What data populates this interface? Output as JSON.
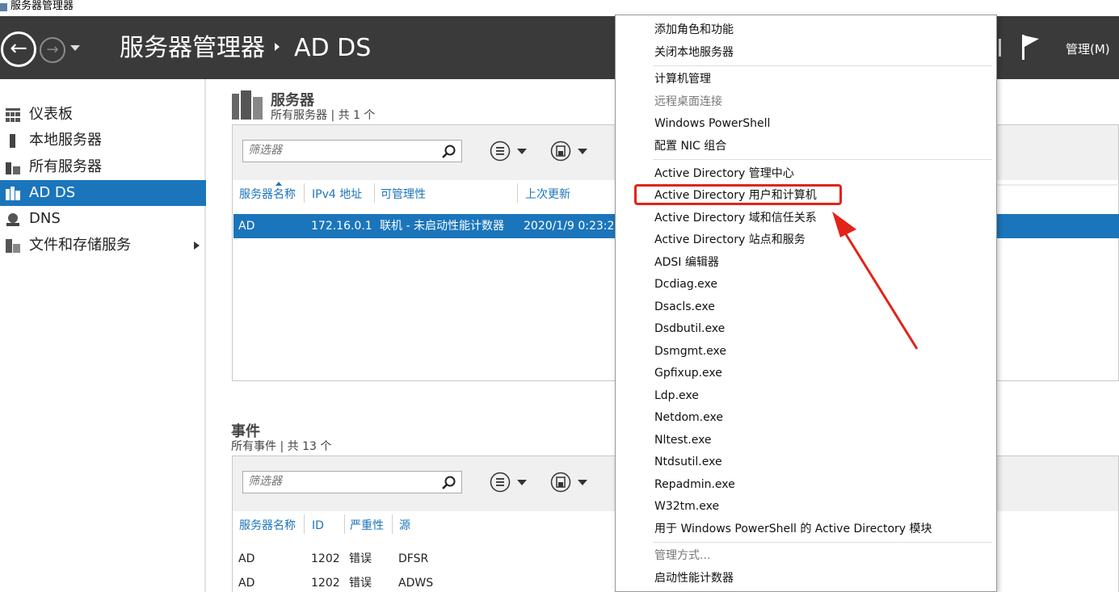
{
  "window": {
    "title": "服务器管理器"
  },
  "header": {
    "breadcrumb_root": "服务器管理器",
    "breadcrumb_current": "AD DS",
    "manage_menu": "管理(M)"
  },
  "sidebar": {
    "items": [
      {
        "label": "仪表板"
      },
      {
        "label": "本地服务器"
      },
      {
        "label": "所有服务器"
      },
      {
        "label": "AD DS"
      },
      {
        "label": "DNS"
      },
      {
        "label": "文件和存储服务"
      }
    ]
  },
  "servers": {
    "title": "服务器",
    "subtitle": "所有服务器 | 共 1 个",
    "filter_placeholder": "筛选器",
    "columns": [
      "服务器名称",
      "IPv4 地址",
      "可管理性",
      "上次更新"
    ],
    "rows": [
      {
        "name": "AD",
        "ipv4": "172.16.0.1",
        "manageability": "联机 - 未启动性能计数器",
        "last_update": "2020/1/9 0:23:2"
      }
    ]
  },
  "events": {
    "title": "事件",
    "subtitle": "所有事件 | 共 13 个",
    "filter_placeholder": "筛选器",
    "columns": [
      "服务器名称",
      "ID",
      "严重性",
      "源"
    ],
    "rows": [
      {
        "server": "AD",
        "id": "1202",
        "severity": "错误",
        "source": "DFSR"
      },
      {
        "server": "AD",
        "id": "1202",
        "severity": "错误",
        "source": "ADWS"
      }
    ]
  },
  "tools_menu": {
    "items": [
      "添加角色和功能",
      "关闭本地服务器",
      "计算机管理",
      "远程桌面连接",
      "Windows PowerShell",
      "配置 NIC 组合",
      "Active Directory 管理中心",
      "Active Directory 用户和计算机",
      "Active Directory 域和信任关系",
      "Active Directory 站点和服务",
      "ADSI 编辑器",
      "Dcdiag.exe",
      "Dsacls.exe",
      "Dsdbutil.exe",
      "Dsmgmt.exe",
      "Gpfixup.exe",
      "Ldp.exe",
      "Netdom.exe",
      "Nltest.exe",
      "Ntdsutil.exe",
      "Repadmin.exe",
      "W32tm.exe",
      "用于 Windows PowerShell 的 Active Directory 模块",
      "管理方式...",
      "启动性能计数器"
    ],
    "highlighted_item": "Active Directory 用户和计算机"
  },
  "colors": {
    "header_bg": "#3a3a3a",
    "accent": "#1b75bb",
    "annotation_red": "#e2231a"
  }
}
